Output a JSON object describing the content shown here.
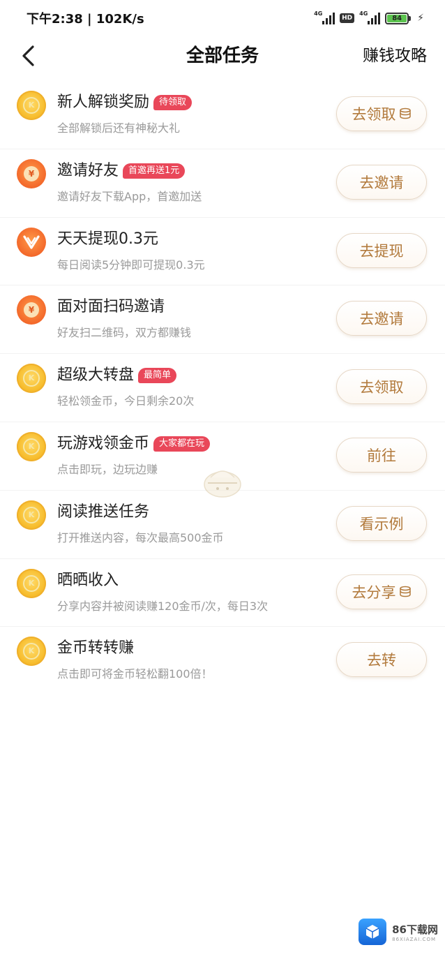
{
  "status_bar": {
    "time_speed": "下午2:38 | 102K/s",
    "network_1": "4G",
    "hd": "HD",
    "network_2": "4G",
    "battery": "84"
  },
  "nav": {
    "title": "全部任务",
    "right_link": "赚钱攻略"
  },
  "tasks": [
    {
      "icon": "coin-icon",
      "title": "新人解锁奖励",
      "badge": "待领取",
      "desc": "全部解锁后还有神秘大礼",
      "button": "去领取",
      "button_icon": true
    },
    {
      "icon": "invite-coin-icon",
      "title": "邀请好友",
      "badge": "首邀再送1元",
      "desc": "邀请好友下载App，首邀加送",
      "button": "去邀请",
      "button_icon": false
    },
    {
      "icon": "withdraw-icon",
      "title": "天天提现0.3元",
      "badge": "",
      "desc": "每日阅读5分钟即可提现0.3元",
      "button": "去提现",
      "button_icon": false
    },
    {
      "icon": "invite-coin-icon",
      "title": "面对面扫码邀请",
      "badge": "",
      "desc": "好友扫二维码，双方都赚钱",
      "button": "去邀请",
      "button_icon": false
    },
    {
      "icon": "coin-icon",
      "title": "超级大转盘",
      "badge": "最简单",
      "desc": "轻松领金币，今日剩余20次",
      "button": "去领取",
      "button_icon": false
    },
    {
      "icon": "coin-icon",
      "title": "玩游戏领金币",
      "badge": "大家都在玩",
      "desc": "点击即玩，边玩边赚",
      "button": "前往",
      "button_icon": false
    },
    {
      "icon": "coin-icon",
      "title": "阅读推送任务",
      "badge": "",
      "desc": "打开推送内容，每次最高500金币",
      "button": "看示例",
      "button_icon": false
    },
    {
      "icon": "coin-icon",
      "title": "晒晒收入",
      "badge": "",
      "desc": "分享内容并被阅读赚120金币/次，每日3次",
      "button": "去分享",
      "button_icon": true
    },
    {
      "icon": "coin-icon",
      "title": "金币转转赚",
      "badge": "",
      "desc": "点击即可将金币轻松翻100倍！",
      "button": "去转",
      "button_icon": false
    }
  ],
  "watermark": {
    "title": "86下载网",
    "sub": "86XIAZAI.COM"
  },
  "colors": {
    "badge": "#e94759",
    "button_text": "#b27a3c",
    "coin_gold": "#f7bd2d",
    "coin_orange": "#f3682a"
  }
}
